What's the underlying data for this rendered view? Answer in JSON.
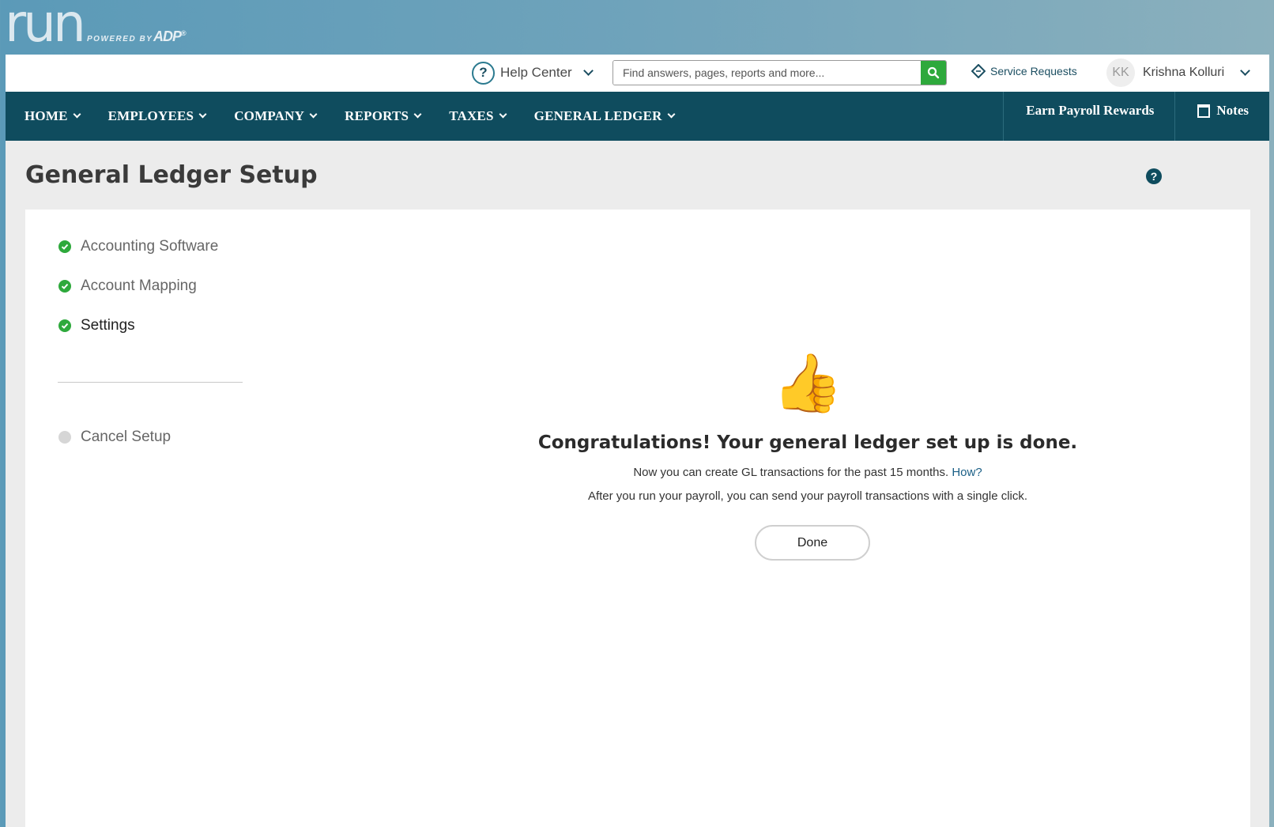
{
  "brand": {
    "logo_text": "run",
    "powered_by": "POWERED BY",
    "adp": "ADP",
    "registered": "®"
  },
  "utility": {
    "help_center": "Help Center",
    "help_symbol": "?",
    "search_placeholder": "Find answers, pages, reports and more...",
    "service_requests": "Service Requests",
    "user_initials": "KK",
    "user_name": "Krishna Kolluri"
  },
  "nav": {
    "items": [
      {
        "label": "HOME"
      },
      {
        "label": "EMPLOYEES"
      },
      {
        "label": "COMPANY"
      },
      {
        "label": "REPORTS"
      },
      {
        "label": "TAXES"
      },
      {
        "label": "GENERAL LEDGER"
      }
    ],
    "earn_rewards": "Earn Payroll Rewards",
    "notes": "Notes"
  },
  "page": {
    "title": "General Ledger Setup",
    "help_symbol": "?"
  },
  "steps": [
    {
      "label": "Accounting Software",
      "status": "complete"
    },
    {
      "label": "Account Mapping",
      "status": "complete"
    },
    {
      "label": "Settings",
      "status": "complete"
    }
  ],
  "cancel_setup": "Cancel Setup",
  "success": {
    "emoji": "👍",
    "heading": "Congratulations! Your general ledger set up is done.",
    "line1": "Now you can create GL transactions for the past 15 months.",
    "how_link": "How?",
    "line2": "After you run your payroll, you can send your payroll transactions with a single click.",
    "done_button": "Done"
  },
  "colors": {
    "nav_bg": "#0f4c5e",
    "success_green": "#2ea93c",
    "link_blue": "#1a5f86"
  }
}
